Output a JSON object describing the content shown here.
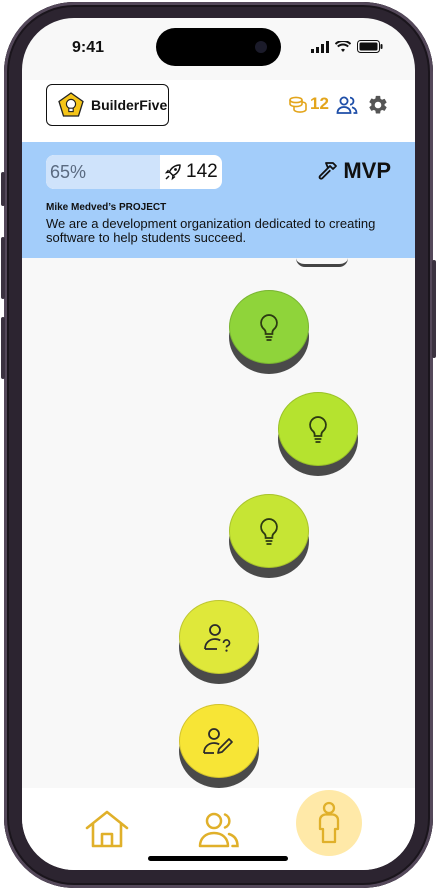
{
  "status_bar": {
    "time": "9:41"
  },
  "header": {
    "logo_text": "BuilderFive",
    "coin_count": "12",
    "coin_color": "#e3a51c",
    "icons": [
      "coins-icon",
      "users-icon",
      "gear-icon"
    ]
  },
  "banner": {
    "progress_percent_label": "65%",
    "progress_value": 0.65,
    "rocket_count": "142",
    "stage_label": "MVP",
    "project_title": "Mike Medved’s PROJECT",
    "project_description": "We are a development organization dedicated to creating software to help students succeed.",
    "background_color": "#a3cdfa"
  },
  "path_nodes": [
    {
      "icon": "lightbulb-icon",
      "color": "#8fd43a"
    },
    {
      "icon": "lightbulb-icon",
      "color": "#b5e32f"
    },
    {
      "icon": "lightbulb-icon",
      "color": "#c6e534"
    },
    {
      "icon": "user-question-icon",
      "color": "#dfe83a"
    },
    {
      "icon": "user-edit-icon",
      "color": "#f7e536"
    }
  ],
  "bottom_nav": {
    "items": [
      {
        "icon": "home-icon",
        "active": false
      },
      {
        "icon": "team-icon",
        "active": false
      },
      {
        "icon": "profile-icon",
        "active": true
      }
    ],
    "icon_color": "#e0b02a"
  }
}
